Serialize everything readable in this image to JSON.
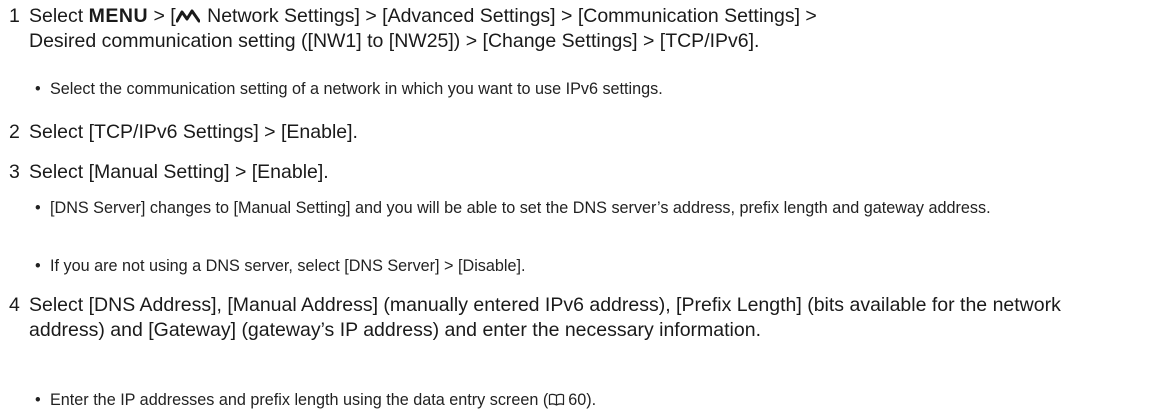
{
  "steps": [
    {
      "number": "1",
      "parts": {
        "select": "Select",
        "menu": "MENU",
        "sep_open": " > [",
        "network_settings": " Network Settings] > [Advanced Settings] > [Communication Settings] >",
        "line2": "Desired communication setting ([NW1] to [NW25]) > [Change Settings] > [TCP/IPv6]."
      },
      "bullets": [
        "Select the communication setting of a network in which you want to use IPv6 settings."
      ]
    },
    {
      "number": "2",
      "text": "Select [TCP/IPv6 Settings] > [Enable].",
      "bullets": []
    },
    {
      "number": "3",
      "text": "Select [Manual Setting] > [Enable].",
      "bullets": [
        "[DNS Server] changes to [Manual Setting] and you will be able to set the DNS server’s address, prefix length and gateway address.",
        "If you are not using a DNS server, select [DNS Server] > [Disable]."
      ]
    },
    {
      "number": "4",
      "text": "Select [DNS Address], [Manual Address] (manually entered IPv6 address), [Prefix Length] (bits available for the network address) and [Gateway] (gateway’s IP address) and enter the necessary information.",
      "bullets": [
        {
          "before": "Enter the IP addresses and prefix length using the data entry screen (",
          "page": "60",
          "after": ")."
        }
      ]
    }
  ],
  "icons": {
    "network": "network-settings-icon",
    "page_ref": "page-reference-book-icon"
  },
  "colors": {
    "text": "#1a1a1a"
  }
}
